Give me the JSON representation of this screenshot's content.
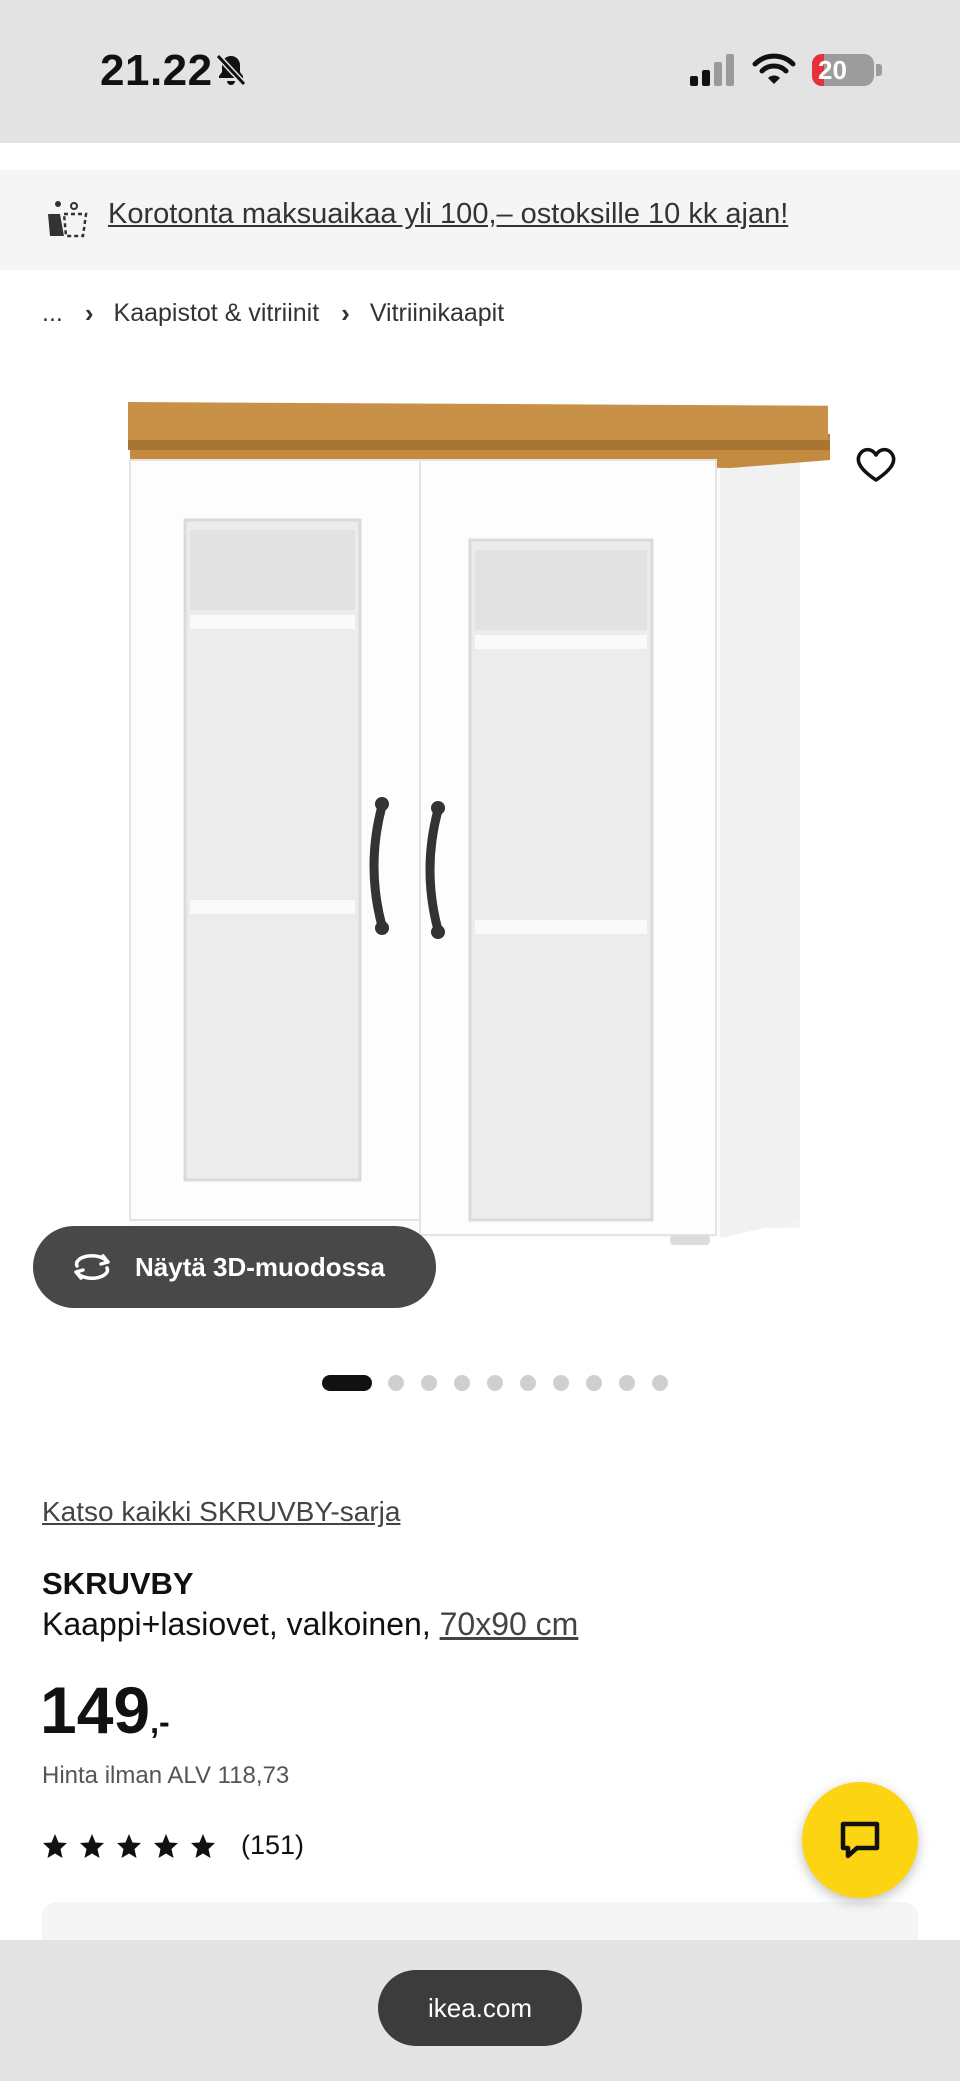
{
  "status_bar": {
    "time": "21.22",
    "battery": "20",
    "battery_level": 0.2,
    "battery_color": "#e8303a",
    "icons": [
      "bell-slash-icon",
      "signal-icon",
      "wifi-icon",
      "battery-charging-icon"
    ]
  },
  "promo": {
    "icon": "payment-split-icon",
    "text": "Korotonta maksuaikaa yli 100,– ostoksille 10 kk ajan!"
  },
  "breadcrumb": {
    "ellipsis": "...",
    "items": [
      "Kaapistot & vitriinit",
      "Vitriinikaapit"
    ]
  },
  "gallery": {
    "view_3d_label": "Näytä 3D-muodossa",
    "image_count": 10,
    "active_index": 0
  },
  "product": {
    "series_link": "Katso kaikki SKRUVBY-sarja",
    "name": "SKRUVBY",
    "description": "Kaappi+lasiovet, valkoinen, ",
    "size": "70x90 cm",
    "price": "149",
    "price_suffix": ",-",
    "vat_text": "Hinta ilman ALV 118,73",
    "rating": 5,
    "review_count": "(151)"
  },
  "chat": {
    "icon": "chat-bubble-icon",
    "color": "#fcd412"
  },
  "browser": {
    "url": "ikea.com"
  }
}
